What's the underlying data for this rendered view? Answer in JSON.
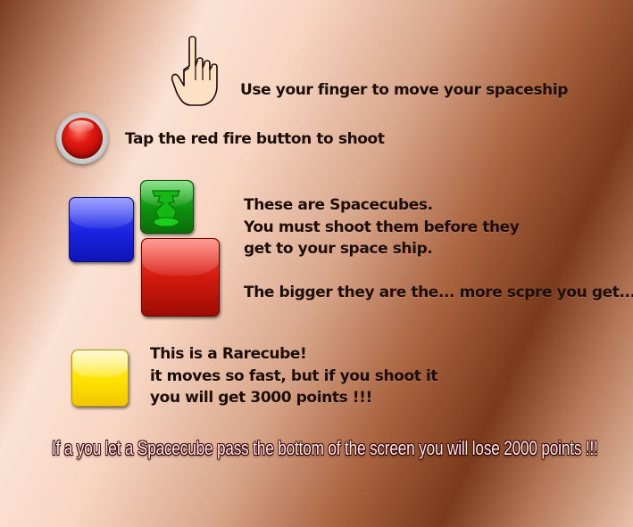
{
  "instructions": {
    "finger": {
      "text": "Use your finger to move your spaceship",
      "icon": "pointing-hand-icon"
    },
    "fire": {
      "text": "Tap the red fire button to shoot",
      "icon": "red-fire-button-icon"
    },
    "spacecubes": {
      "lines": [
        "These are Spacecubes.",
        "You must shoot them before they",
        "get to your space ship.",
        "",
        "The bigger they are the... more scpre you get..."
      ],
      "icons": [
        "blue-cube-icon",
        "green-cube-icon",
        "red-cube-icon"
      ]
    },
    "rarecube": {
      "lines": [
        "This is a Rarecube!",
        "it moves so fast, but if you shoot it",
        "you will get 3000 points !!!"
      ],
      "icon": "yellow-cube-icon"
    },
    "warning": "If a you let a Spacecube pass the bottom of the screen you will lose 2000 points !!!"
  },
  "colors": {
    "text": "#1e0d06",
    "warning_text": "#ffe8e8",
    "cube_blue": "#1a22e0",
    "cube_green": "#0d8f0d",
    "cube_red": "#d31a10",
    "cube_yellow": "#ffe400",
    "fire_button": "#e01a10"
  }
}
